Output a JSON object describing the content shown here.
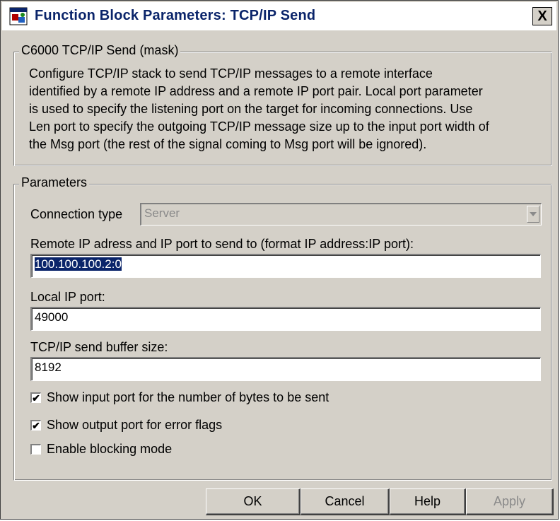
{
  "window": {
    "title": "Function Block Parameters: TCP/IP Send",
    "close_symbol": "X",
    "icon": "simulink-block-icon"
  },
  "mask": {
    "group_title": "C6000 TCP/IP Send (mask)",
    "description_lines": [
      "Configure TCP/IP stack  to send TCP/IP messages to a remote interface",
      "identified by a remote  IP address and a remote IP port pair. Local port parameter",
      "is used to specify the listening port on the target for incoming connections. Use",
      "Len port to specify the outgoing TCP/IP message size up to the input port width of",
      "the Msg port (the rest of the signal coming to Msg port will be ignored)."
    ]
  },
  "parameters": {
    "group_title": "Parameters",
    "connection_type": {
      "label": "Connection type",
      "value": "Server"
    },
    "remote_ip": {
      "label": "Remote IP adress and IP port to send to (format IP address:IP port):",
      "value": "100.100.100.2:0"
    },
    "local_port": {
      "label": "Local IP port:",
      "value": "49000"
    },
    "buffer_size": {
      "label": "TCP/IP send buffer size:",
      "value": "8192"
    },
    "checkboxes": [
      {
        "label": "Show input port for the number of bytes to be sent",
        "checked": true,
        "mark": "✔"
      },
      {
        "label": "Show output port for error flags",
        "checked": true,
        "mark": "✔"
      },
      {
        "label": "Enable blocking mode",
        "checked": false,
        "mark": ""
      }
    ]
  },
  "buttons": {
    "ok": "OK",
    "cancel": "Cancel",
    "help": "Help",
    "apply": "Apply"
  }
}
